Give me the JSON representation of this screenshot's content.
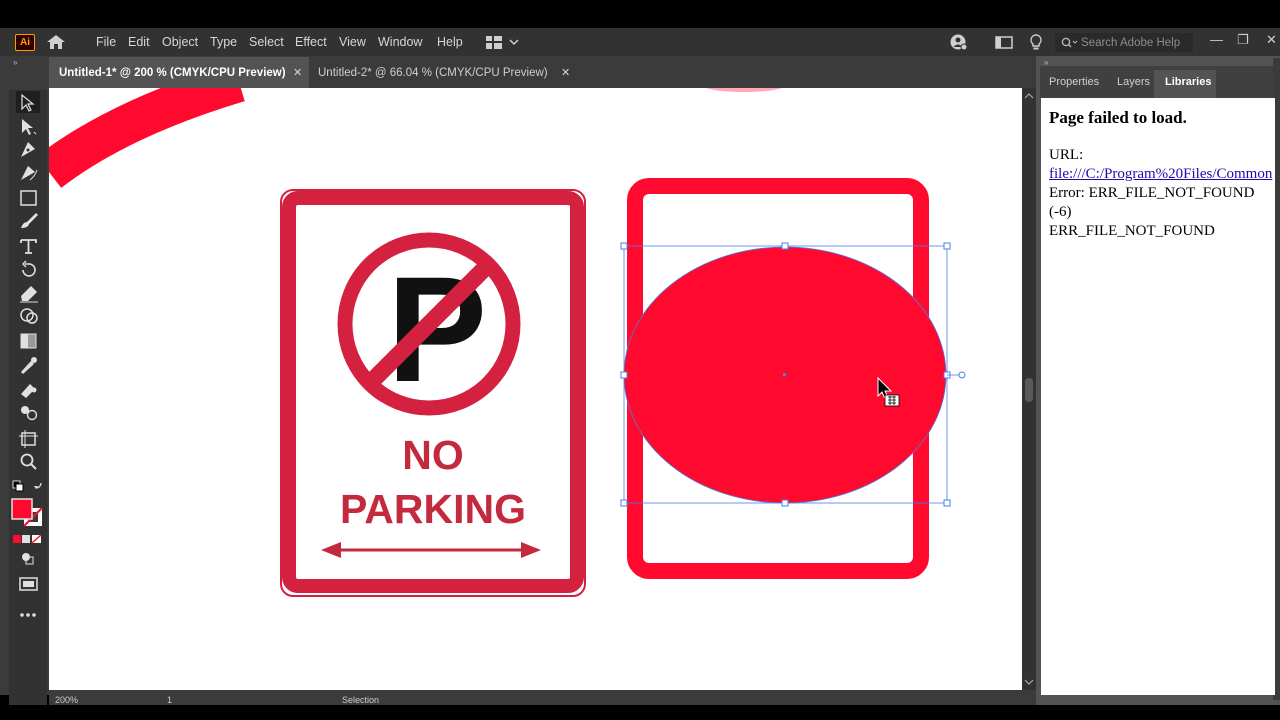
{
  "app": {
    "logo": "Ai"
  },
  "menu": {
    "items": [
      "File",
      "Edit",
      "Object",
      "Type",
      "Select",
      "Effect",
      "View",
      "Window",
      "Help"
    ]
  },
  "search": {
    "placeholder": "Search Adobe Help"
  },
  "tabs": [
    {
      "label": "Untitled-1* @ 200 % (CMYK/CPU Preview)",
      "active": true
    },
    {
      "label": "Untitled-2* @ 66.04 % (CMYK/CPU Preview)",
      "active": false
    }
  ],
  "panel": {
    "tabs": [
      "Properties",
      "Layers",
      "Libraries"
    ],
    "active_tab": "Libraries",
    "error_title": "Page failed to load.",
    "url_label": "URL:",
    "url_value": "file:///C:/Program%20Files/Common",
    "error_line1": "Error: ERR_FILE_NOT_FOUND",
    "error_line2": "(-6)",
    "error_line3": "ERR_FILE_NOT_FOUND"
  },
  "artboard": {
    "sign_text_line1": "NO",
    "sign_text_line2": "PARKING",
    "sign_letter": "P"
  },
  "status": {
    "zoom": "200%",
    "page": "1",
    "tool": "Selection"
  },
  "colors": {
    "accent_red": "#ff0a2e",
    "sign_red": "#d4213f",
    "selection_blue": "#4a7fe8",
    "ui_dark": "#323232"
  },
  "icons": [
    "home-icon",
    "workspace-icon",
    "user-icon",
    "arrange-icon",
    "lightbulb-icon",
    "search-icon",
    "minimize-icon",
    "restore-icon",
    "close-icon"
  ]
}
